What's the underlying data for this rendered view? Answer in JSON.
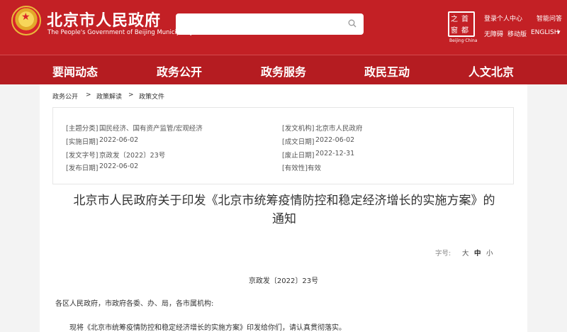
{
  "header": {
    "site_name": "北京市人民政府",
    "site_subtitle": "The People's Government of Beijing Municipality",
    "search_placeholder": "",
    "capital_logo": {
      "lt": "之",
      "rt": "首",
      "lb": "窗",
      "rb": "都",
      "caption": "Beijing·China"
    },
    "links": {
      "login": "登录个人中心",
      "smart_qa": "智能问答",
      "accessibility": "无障碍",
      "mobile": "移动版",
      "english": "ENGLISH",
      "english_caret": "▾"
    }
  },
  "nav": {
    "items": [
      "要闻动态",
      "政务公开",
      "政务服务",
      "政民互动",
      "人文北京"
    ]
  },
  "breadcrumb": {
    "items": [
      "政务公开",
      "政策解读",
      "政策文件"
    ],
    "separator": ">"
  },
  "meta": {
    "category_label": "[主题分类]",
    "category_value": "国民经济、国有资产监管/宏观经济",
    "issuer_label": "[发文机构]",
    "issuer_value": "北京市人民政府",
    "effective_label": "[实施日期]",
    "effective_value": "2022-06-02",
    "created_label": "[成文日期]",
    "created_value": "2022-06-02",
    "docno_label": "[发文字号]",
    "docno_value": "京政发〔2022〕23号",
    "abolish_label": "[废止日期]",
    "abolish_value": "2022-12-31",
    "publish_label": "[发布日期]",
    "publish_value": "2022-06-02",
    "validity_label": "[有效性]",
    "validity_value": "有效"
  },
  "document": {
    "title_line1": "北京市人民政府关于印发《北京市统筹疫情防控和稳定经济增长的实施方案》的",
    "title_line2": "通知",
    "font_size_label": "字号:",
    "font_sizes": [
      "大",
      "中",
      "小"
    ],
    "doc_number": "京政发〔2022〕23号",
    "addressee": "各区人民政府，市政府各委、办、局，各市属机构:",
    "first_paragraph": "现将《北京市统筹疫情防控和稳定经济增长的实施方案》印发给你们，请认真贯彻落实。"
  },
  "colors": {
    "brand_red": "#c32025",
    "nav_red": "#b51c21"
  }
}
